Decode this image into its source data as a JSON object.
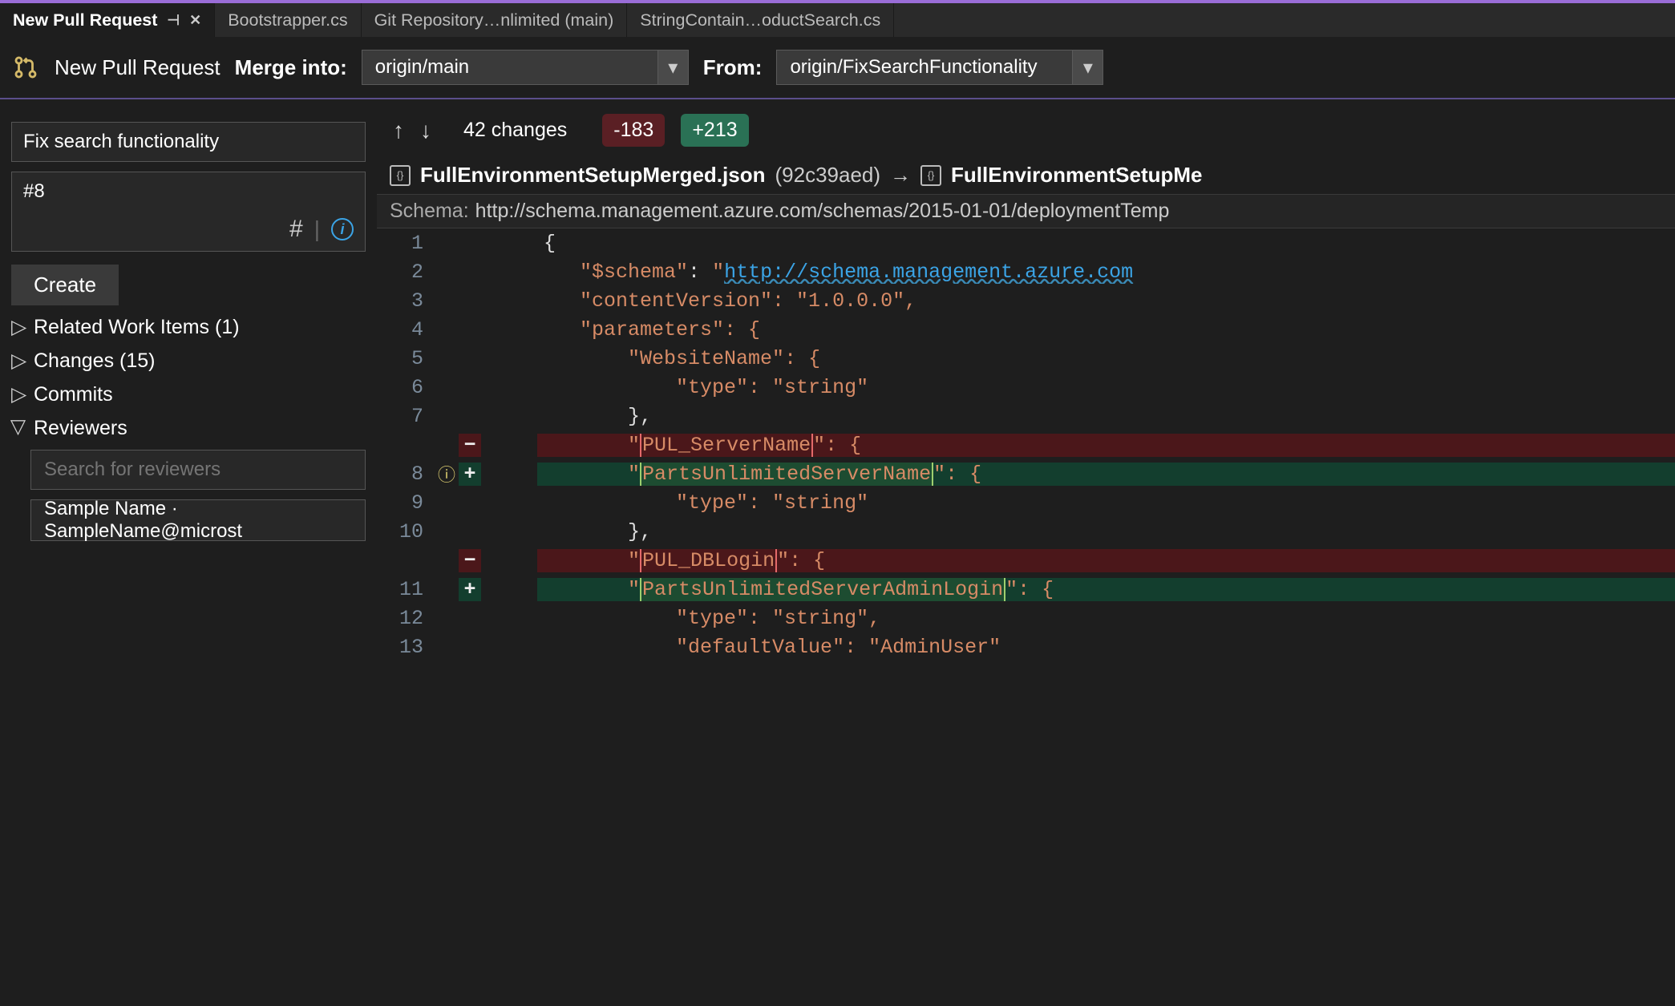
{
  "tabs": {
    "active": "New Pull Request",
    "others": [
      "Bootstrapper.cs",
      "Git Repository…nlimited (main)",
      "StringContain…oductSearch.cs"
    ]
  },
  "pr": {
    "header_title": "New Pull Request",
    "merge_into_label": "Merge into:",
    "merge_into_value": "origin/main",
    "from_label": "From:",
    "from_value": "origin/FixSearchFunctionality",
    "title_input": "Fix search functionality",
    "description": "#8",
    "create_label": "Create"
  },
  "tree": {
    "related": "Related Work Items (1)",
    "changes": "Changes (15)",
    "commits": "Commits",
    "reviewers": "Reviewers",
    "reviewer_search_placeholder": "Search for reviewers",
    "reviewer_entry": "Sample Name · SampleName@microst"
  },
  "diff": {
    "changes_label": "42 changes",
    "minus": "-183",
    "plus": "+213",
    "file_left_name": "FullEnvironmentSetupMerged.json",
    "file_left_hash": "(92c39aed)",
    "file_right_name": "FullEnvironmentSetupMe",
    "schema_label": "Schema:",
    "schema_url": "http://schema.management.azure.com/schemas/2015-01-01/deploymentTemp"
  },
  "code": {
    "l1": "{",
    "l2_key": "\"$schema\"",
    "l2_url": "http://schema.management.azure.com",
    "l3": "\"contentVersion\": \"1.0.0.0\",",
    "l4": "\"parameters\": {",
    "l5": "\"WebsiteName\": {",
    "l6": "\"type\": \"string\"",
    "l7": "},",
    "rm1_pre": "\"",
    "rm1_word": "PUL_ServerName",
    "rm1_post": "\": {",
    "ad1_pre": "\"",
    "ad1_word": "PartsUnlimitedServerName",
    "ad1_post": "\": {",
    "l9": "\"type\": \"string\"",
    "l10": "},",
    "rm2_pre": "\"",
    "rm2_word": "PUL_DBLogin",
    "rm2_post": "\": {",
    "ad2_pre": "\"",
    "ad2_word": "PartsUnlimitedServerAdminLogin",
    "ad2_post": "\": {",
    "l12": "\"type\": \"string\",",
    "l13": "\"defaultValue\": \"AdminUser\""
  }
}
